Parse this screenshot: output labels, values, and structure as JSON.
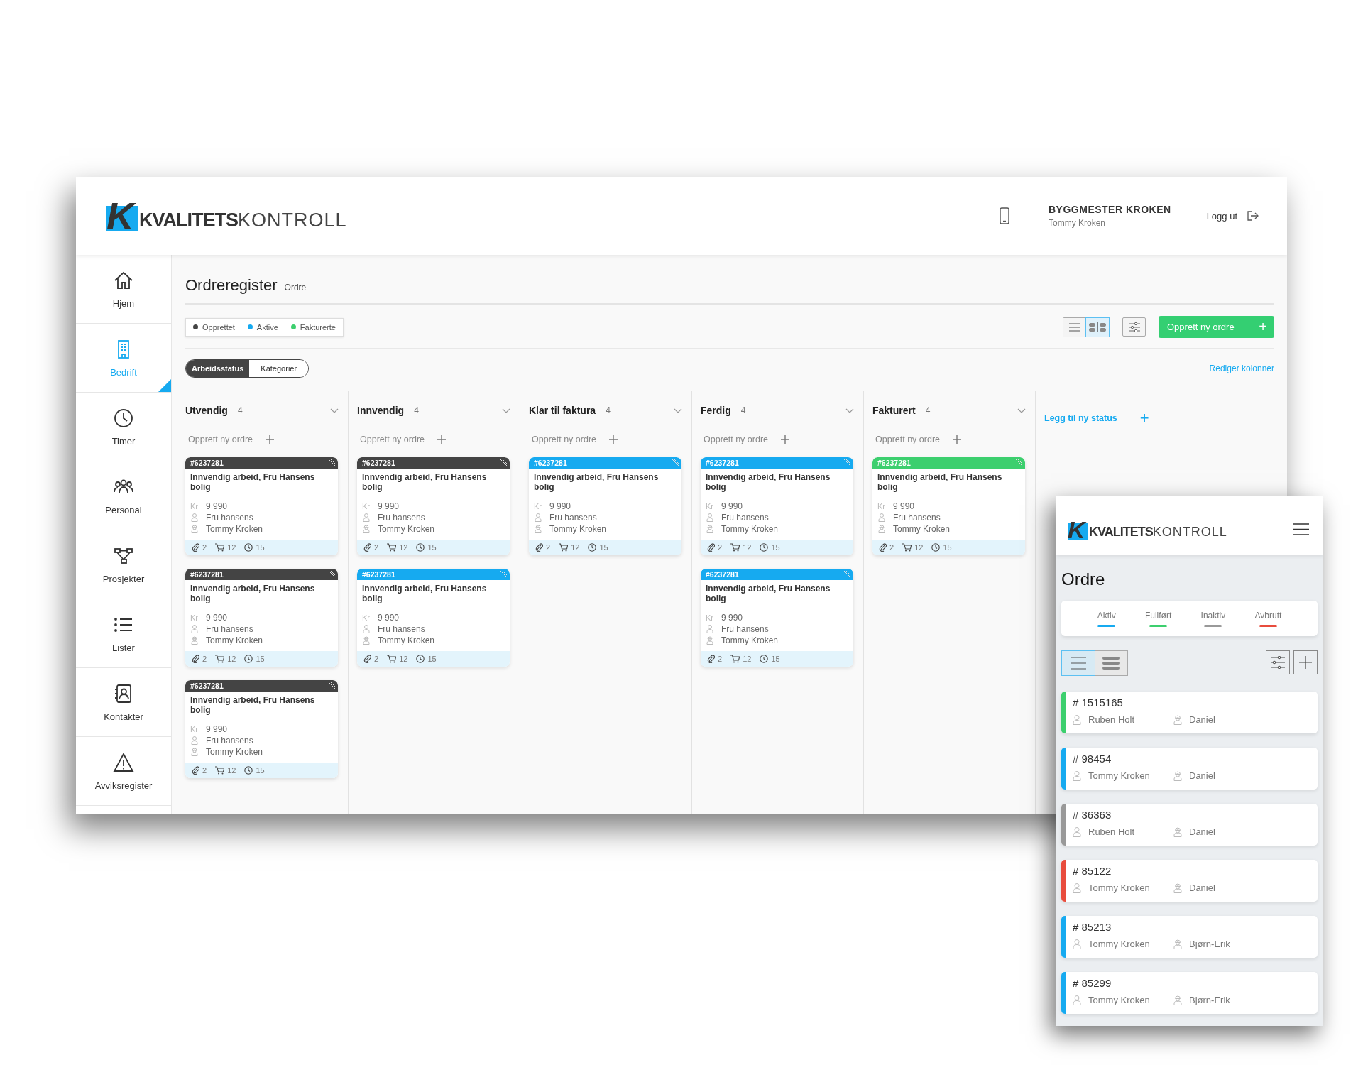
{
  "logo": {
    "mark": "K",
    "bold": "KVALITETS",
    "light": "KONTROLL"
  },
  "header": {
    "company": "BYGGMESTER KROKEN",
    "user": "Tommy Kroken",
    "logout": "Logg ut"
  },
  "sidebar": {
    "items": [
      {
        "label": "Hjem",
        "selected": false
      },
      {
        "label": "Bedrift",
        "selected": true
      },
      {
        "label": "Timer",
        "selected": false
      },
      {
        "label": "Personal",
        "selected": false
      },
      {
        "label": "Prosjekter",
        "selected": false
      },
      {
        "label": "Lister",
        "selected": false
      },
      {
        "label": "Kontakter",
        "selected": false
      },
      {
        "label": "Avviksregister",
        "selected": false
      }
    ]
  },
  "page": {
    "title": "Ordreregister",
    "breadcrumb": "Ordre"
  },
  "legend": [
    {
      "label": "Opprettet",
      "color": "#444444"
    },
    {
      "label": "Aktive",
      "color": "#16aaf0"
    },
    {
      "label": "Fakturerte",
      "color": "#3ccf6e"
    }
  ],
  "view_toggle": [
    {
      "kind": "list",
      "selected": false
    },
    {
      "kind": "board",
      "selected": true
    }
  ],
  "create_button": {
    "label": "Opprett ny ordre",
    "icon": "+"
  },
  "group_toggle": [
    {
      "label": "Arbeidsstatus",
      "selected": true
    },
    {
      "label": "Kategorier",
      "selected": false
    }
  ],
  "edit_columns": "Rediger kolonner",
  "columns": [
    {
      "name": "Utvendig",
      "count": "4",
      "create": "Opprett ny ordre",
      "cards": [
        {
          "number": "#6237281",
          "color": "#444444",
          "title": "Innvendig arbeid, Fru Hansens bolig",
          "currency": "Kr",
          "amount": "9 990",
          "customer": "Fru hansens",
          "worker": "Tommy Kroken",
          "attachments": "2",
          "items": "12",
          "hours": "15"
        },
        {
          "number": "#6237281",
          "color": "#444444",
          "title": "Innvendig arbeid, Fru Hansens bolig",
          "currency": "Kr",
          "amount": "9 990",
          "customer": "Fru hansens",
          "worker": "Tommy Kroken",
          "attachments": "2",
          "items": "12",
          "hours": "15"
        },
        {
          "number": "#6237281",
          "color": "#444444",
          "title": "Innvendig arbeid, Fru Hansens bolig",
          "currency": "Kr",
          "amount": "9 990",
          "customer": "Fru hansens",
          "worker": "Tommy Kroken",
          "attachments": "2",
          "items": "12",
          "hours": "15"
        }
      ]
    },
    {
      "name": "Innvendig",
      "count": "4",
      "create": "Opprett ny ordre",
      "cards": [
        {
          "number": "#6237281",
          "color": "#444444",
          "title": "Innvendig arbeid, Fru Hansens bolig",
          "currency": "Kr",
          "amount": "9 990",
          "customer": "Fru hansens",
          "worker": "Tommy Kroken",
          "attachments": "2",
          "items": "12",
          "hours": "15"
        },
        {
          "number": "#6237281",
          "color": "#16aaf0",
          "title": "Innvendig arbeid, Fru Hansens bolig",
          "currency": "Kr",
          "amount": "9 990",
          "customer": "Fru hansens",
          "worker": "Tommy Kroken",
          "attachments": "2",
          "items": "12",
          "hours": "15"
        }
      ]
    },
    {
      "name": "Klar til faktura",
      "count": "4",
      "create": "Opprett ny ordre",
      "cards": [
        {
          "number": "#6237281",
          "color": "#16aaf0",
          "title": "Innvendig arbeid, Fru Hansens bolig",
          "currency": "Kr",
          "amount": "9 990",
          "customer": "Fru hansens",
          "worker": "Tommy Kroken",
          "attachments": "2",
          "items": "12",
          "hours": "15"
        }
      ]
    },
    {
      "name": "Ferdig",
      "count": "4",
      "create": "Opprett ny ordre",
      "cards": [
        {
          "number": "#6237281",
          "color": "#16aaf0",
          "title": "Innvendig arbeid, Fru Hansens bolig",
          "currency": "Kr",
          "amount": "9 990",
          "customer": "Fru hansens",
          "worker": "Tommy Kroken",
          "attachments": "2",
          "items": "12",
          "hours": "15"
        },
        {
          "number": "#6237281",
          "color": "#16aaf0",
          "title": "Innvendig arbeid, Fru Hansens bolig",
          "currency": "Kr",
          "amount": "9 990",
          "customer": "Fru hansens",
          "worker": "Tommy Kroken",
          "attachments": "2",
          "items": "12",
          "hours": "15"
        }
      ]
    },
    {
      "name": "Fakturert",
      "count": "4",
      "create": "Opprett ny ordre",
      "cards": [
        {
          "number": "#6237281",
          "color": "#3ccf6e",
          "title": "Innvendig arbeid, Fru Hansens bolig",
          "currency": "Kr",
          "amount": "9 990",
          "customer": "Fru hansens",
          "worker": "Tommy Kroken",
          "attachments": "2",
          "items": "12",
          "hours": "15"
        }
      ]
    }
  ],
  "add_status": {
    "label": "Legg til ny status",
    "icon": "+"
  },
  "mobile": {
    "logo": {
      "mark": "K",
      "bold": "KVALITETS",
      "light": "KONTROLL"
    },
    "title": "Ordre",
    "tabs": [
      {
        "label": "Aktiv",
        "color": "#16aaf0"
      },
      {
        "label": "Fullført",
        "color": "#3ccf6e"
      },
      {
        "label": "Inaktiv",
        "color": "#999999"
      },
      {
        "label": "Avbrutt",
        "color": "#e84c3d"
      }
    ],
    "view_toggle": [
      {
        "kind": "list",
        "selected": true
      },
      {
        "kind": "compact",
        "selected": false
      }
    ],
    "orders": [
      {
        "number": "# 1515165",
        "customer": "Ruben Holt",
        "worker": "Daniel",
        "color": "#3ccf6e"
      },
      {
        "number": "# 98454",
        "customer": "Tommy Kroken",
        "worker": "Daniel",
        "color": "#16aaf0"
      },
      {
        "number": "# 36363",
        "customer": "Ruben Holt",
        "worker": "Daniel",
        "color": "#999999"
      },
      {
        "number": "# 85122",
        "customer": "Tommy Kroken",
        "worker": "Daniel",
        "color": "#e84c3d"
      },
      {
        "number": "# 85213",
        "customer": "Tommy Kroken",
        "worker": "Bjørn-Erik",
        "color": "#16aaf0"
      },
      {
        "number": "# 85299",
        "customer": "Tommy Kroken",
        "worker": "Bjørn-Erik",
        "color": "#16aaf0"
      }
    ]
  }
}
